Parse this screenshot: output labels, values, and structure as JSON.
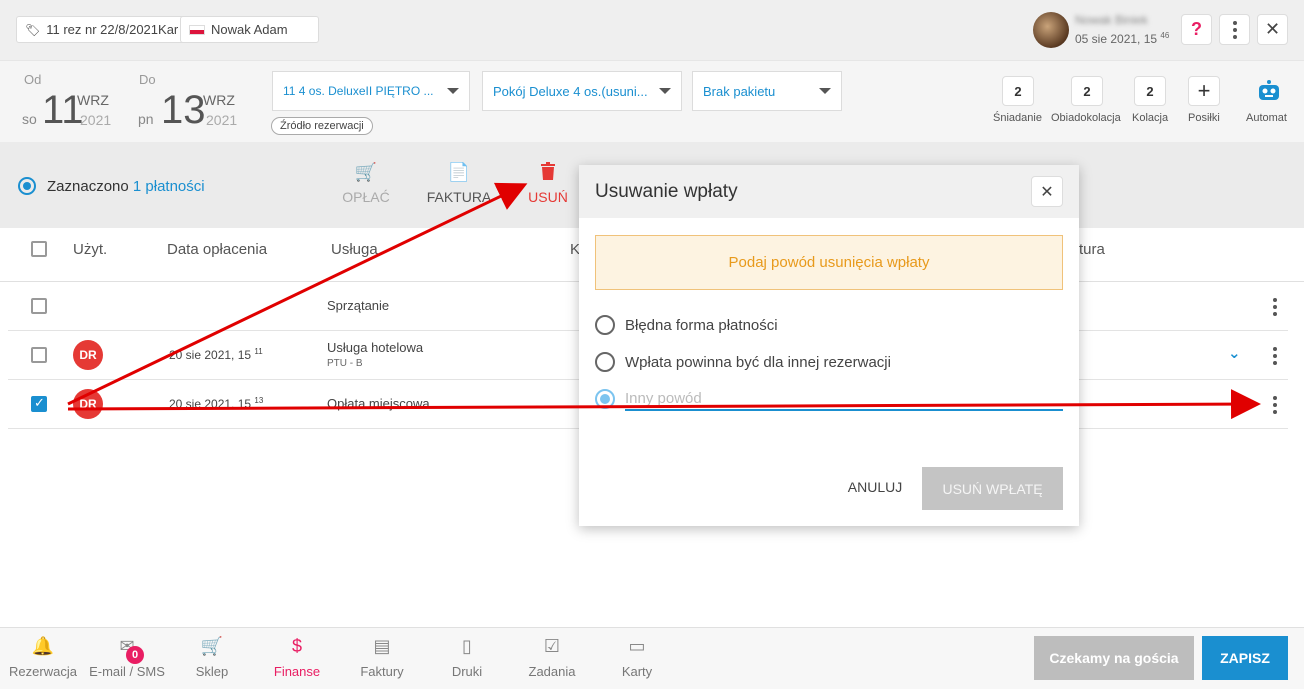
{
  "header": {
    "reservation_chip": "11 rez nr 22/8/2021Kar",
    "guest_chip": "Nowak Adam",
    "user_name": "Nowak Biniek",
    "user_time": "05 sie 2021, 15",
    "user_time_sup": "46",
    "help_label": "?",
    "close_label": "✕"
  },
  "dates": {
    "from_label": "Od",
    "from_weekday": "so",
    "from_day": "11",
    "from_month": "WRZ",
    "from_year": "2021",
    "to_label": "Do",
    "to_weekday": "pn",
    "to_day": "13",
    "to_month": "WRZ",
    "to_year": "2021"
  },
  "selects": {
    "room": "11 4 os. DeluxeII PIĘTRO ...",
    "room_type": "Pokój Deluxe 4 os.(usuni...",
    "package": "Brak pakietu",
    "source_chip": "Źródło rezerwacji"
  },
  "meals": [
    {
      "count": "2",
      "label": "Śniadanie"
    },
    {
      "count": "2",
      "label": "Obiadokolacja"
    },
    {
      "count": "2",
      "label": "Kolacja"
    },
    {
      "count": "+",
      "label": "Posiłki"
    },
    {
      "count": "",
      "label": "Automat"
    }
  ],
  "selection": {
    "prefix": "Zaznaczono",
    "count": "1 płatności",
    "actions": {
      "pay": "OPŁAĆ",
      "invoice": "FAKTURA",
      "delete": "USUŃ"
    }
  },
  "table": {
    "headers": {
      "user": "Użyt.",
      "paid_date": "Data opłacenia",
      "service": "Usługa",
      "k": "K",
      "invoice": "tura"
    },
    "rows": [
      {
        "user": "",
        "date": "",
        "date_sup": "",
        "service": "Sprzątanie",
        "sub": ""
      },
      {
        "user": "DR",
        "date": "20 sie 2021, 15",
        "date_sup": "11",
        "service": "Usługa hotelowa",
        "sub": "PTU - B"
      },
      {
        "user": "DR",
        "date": "20 sie 2021, 15",
        "date_sup": "13",
        "service": "Opłata miejscowa",
        "sub": ""
      }
    ]
  },
  "modal": {
    "title": "Usuwanie wpłaty",
    "warning": "Podaj powód usunięcia wpłaty",
    "options": [
      "Błędna forma płatności",
      "Wpłata powinna być dla innej rezerwacji"
    ],
    "other_placeholder": "Inny powód",
    "cancel": "ANULUJ",
    "confirm": "USUŃ WPŁATĘ"
  },
  "footer": {
    "nav": [
      "Rezerwacja",
      "E-mail / SMS",
      "Sklep",
      "Finanse",
      "Faktury",
      "Druki",
      "Zadania",
      "Karty"
    ],
    "email_badge": "0",
    "wait_button": "Czekamy na gościa",
    "save_button": "ZAPISZ"
  },
  "colors": {
    "accent": "#1a8fd0",
    "danger": "#e53935",
    "active_nav": "#e91e63",
    "annotation_arrow": "#e00000"
  }
}
